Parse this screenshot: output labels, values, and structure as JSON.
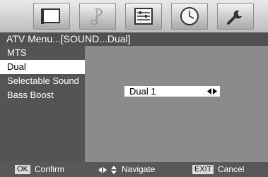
{
  "icon_bar": {
    "icons": [
      "picture-icon",
      "music-note-icon",
      "settings-panel-icon",
      "clock-icon",
      "wrench-icon"
    ]
  },
  "title": "ATV Menu...[SOUND...Dual]",
  "menu": {
    "items": [
      {
        "label": "MTS"
      },
      {
        "label": "Dual",
        "selected": true
      },
      {
        "label": "Selectable Sound"
      },
      {
        "label": "Bass Boost"
      }
    ]
  },
  "panel": {
    "option_value": "Dual 1"
  },
  "help_bar": {
    "ok_key": "OK",
    "ok_label": "Confirm",
    "navigate_label": "Navigate",
    "exit_key": "EXIT",
    "exit_label": "Cancel"
  },
  "colors": {
    "title_bar": "#505050",
    "menu_background": "#545454",
    "panel_background": "#8b8b8b",
    "selection": "#ffffff"
  }
}
